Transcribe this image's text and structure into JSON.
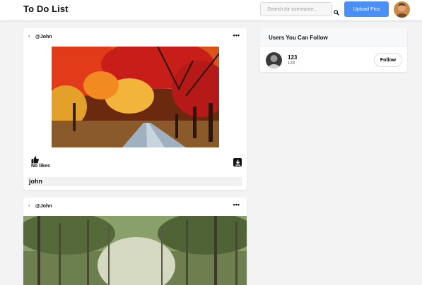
{
  "app": {
    "title": "To Do List"
  },
  "header": {
    "search_placeholder": "Search for username...",
    "upload_label": "Upload Pics"
  },
  "posts": [
    {
      "author": "@John",
      "likes": "No likes",
      "caption": "john"
    },
    {
      "author": "@John"
    }
  ],
  "follow_panel": {
    "title": "Users You Can Follow",
    "users": [
      {
        "name": "123",
        "handle": "123",
        "button_label": "Follow"
      }
    ]
  },
  "icons": {
    "search": "search-icon",
    "more": "more-options-icon",
    "like": "thumbs-up-icon",
    "download": "download-icon"
  },
  "colors": {
    "accent": "#4a8ff5",
    "background": "#f3f3f4"
  }
}
